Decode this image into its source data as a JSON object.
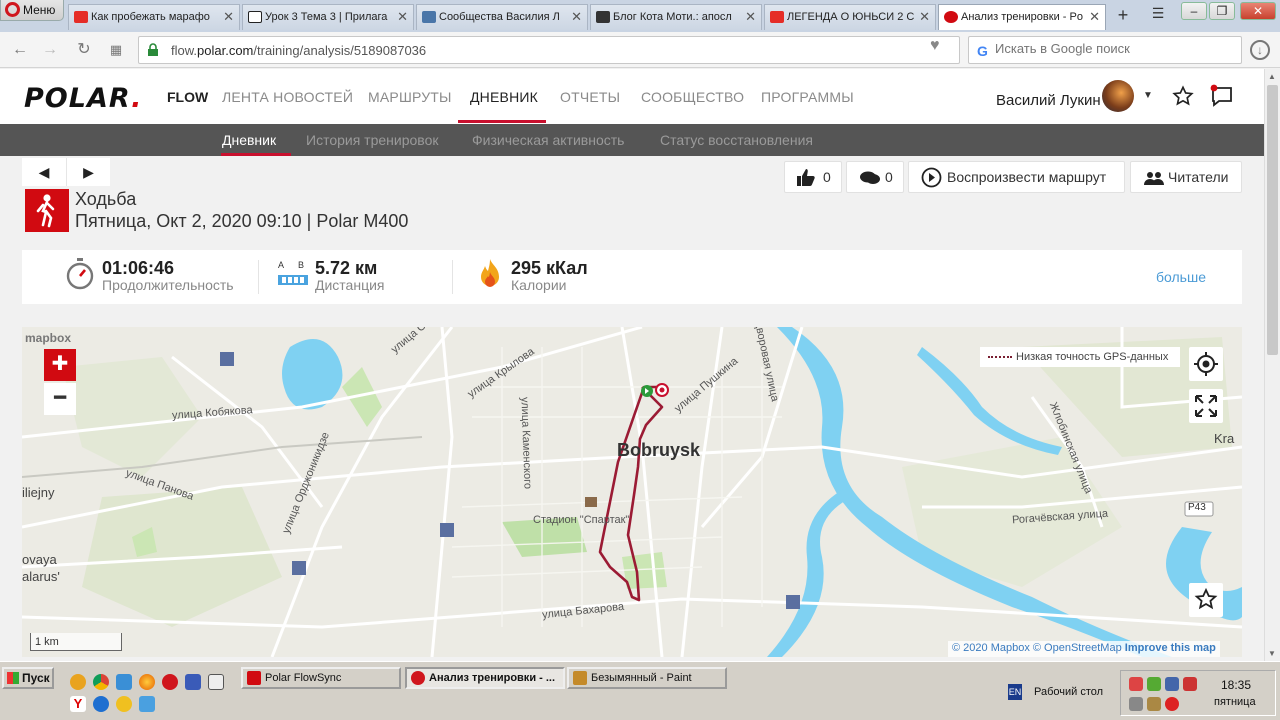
{
  "browser": {
    "menu_label": "Меню",
    "tabs": [
      {
        "title": "Как пробежать марафо",
        "color": "#e52d27"
      },
      {
        "title": "Урок 3 Тема 3 | Прилага",
        "color": "#222222"
      },
      {
        "title": "Сообщества Василия Л",
        "color": "#4a76a8"
      },
      {
        "title": "Блог Кота Моти.: апосл",
        "color": "#333333"
      },
      {
        "title": "ЛЕГЕНДА О ЮНЬСИ 2 С",
        "color": "#e52d27"
      },
      {
        "title": "Анализ тренировки - Po",
        "color": "#d10a11"
      }
    ],
    "new_tab_label": "+",
    "url_prefix": "flow.",
    "url_host": "polar.com",
    "url_path": "/training/analysis/5189087036",
    "search_placeholder": "Искать в Google поиск"
  },
  "polar": {
    "logo": "POLAR",
    "flow": "FLOW",
    "main_nav": [
      "ЛЕНТА НОВОСТЕЙ",
      "МАРШРУТЫ",
      "ДНЕВНИК",
      "ОТЧЕТЫ",
      "СООБЩЕСТВО",
      "ПРОГРАММЫ"
    ],
    "active_nav": "ДНЕВНИК",
    "user_name": "Василий Лукин",
    "sub_nav": [
      "Дневник",
      "История тренировок",
      "Физическая активность",
      "Статус восстановления"
    ],
    "active_sub": "Дневник",
    "accent": "#d10a11"
  },
  "training": {
    "sport": "Ходьба",
    "meta": "Пятница, Окт 2, 2020 09:10 | Polar M400",
    "likes": "0",
    "comments": "0",
    "replay_label": "Воспроизвести маршрут",
    "readers_label": "Читатели"
  },
  "summary": {
    "duration_value": "01:06:46",
    "duration_label": "Продолжительность",
    "distance_icon_a": "A",
    "distance_icon_b": "B",
    "distance_value": "5.72 км",
    "distance_label": "Дистанция",
    "calories_value": "295 кКал",
    "calories_label": "Калории",
    "more_label": "больше"
  },
  "map": {
    "mapbox_logo": "mapbox",
    "city": "Bobruysk",
    "gps_legend": "Низкая точность GPS-данных",
    "scale": "1 km",
    "attribution_copy": "© 2020 Mapbox ©",
    "attribution_osm": "OpenStreetMap",
    "attribution_improve": "Improve this map",
    "labels": {
      "krylova": "улица Крылова",
      "pushkina": "улица Пушкина",
      "dvorovaya": "Дворовая улица",
      "kobyakova": "улица Кобякова",
      "kamenskogo": "улица Каменского",
      "ordzhonikidze": "улица Орджоникидзе",
      "panova": "улица Панова",
      "stadion": "Стадион \"Спартак\"",
      "bakharova": "улица Бахарова",
      "zhlobinskaya": "Жлобинская улица",
      "rogachevskaya": "Рогачёвская улица",
      "p43": "P43",
      "kra": "Kra",
      "liejny": "iliejny",
      "ovaya": "ovaya",
      "alarus": "alarus'",
      "ulitsa_top": "улица С"
    }
  },
  "taskbar": {
    "start": "Пуск",
    "tasks": [
      {
        "label": "Polar FlowSync",
        "color": "#d10a11",
        "active": false
      },
      {
        "label": "Анализ тренировки - ...",
        "color": "#d0161d",
        "active": true
      },
      {
        "label": "Безымянный - Paint",
        "color": "#c48a2a",
        "active": false
      }
    ],
    "lang": "EN",
    "desktop": "Рабочий стол",
    "time": "18:35",
    "day": "пятница"
  }
}
